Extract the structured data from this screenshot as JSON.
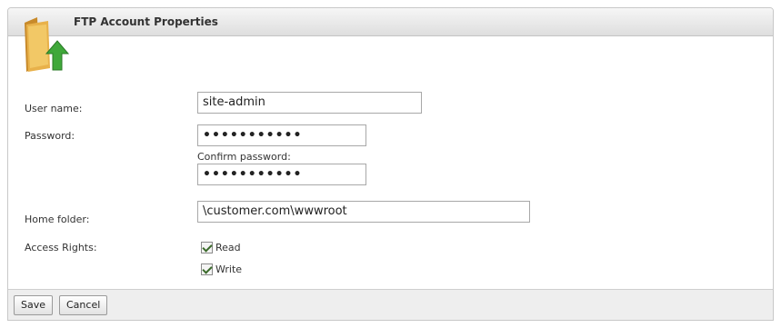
{
  "header": {
    "title": "FTP Account Properties",
    "icon": "folder-upload-icon"
  },
  "form": {
    "username_label": "User name:",
    "username_value": "site-admin",
    "password_label": "Password:",
    "password_value": "•••••••••••",
    "confirm_label": "Confirm password:",
    "confirm_value": "•••••••••••",
    "home_label": "Home folder:",
    "home_value": "\\customer.com\\wwwroot",
    "rights_label": "Access Rights:",
    "rights": [
      {
        "label": "Read",
        "checked": true
      },
      {
        "label": "Write",
        "checked": true
      }
    ]
  },
  "footer": {
    "save_label": "Save",
    "cancel_label": "Cancel"
  }
}
